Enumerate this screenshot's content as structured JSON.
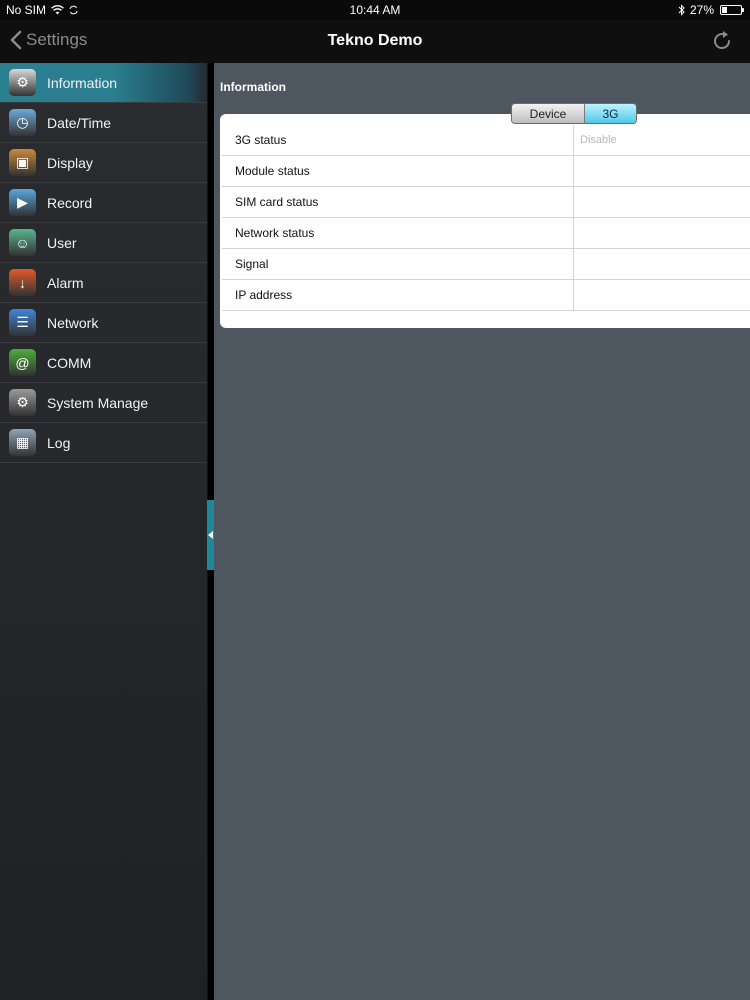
{
  "status_bar": {
    "carrier": "No SIM",
    "time": "10:44 AM",
    "battery": "27%",
    "battery_level": 0.27,
    "icons": [
      "wifi-icon",
      "sync-icon",
      "bluetooth-icon",
      "battery-icon"
    ]
  },
  "nav": {
    "back_label": "Settings",
    "title": "Tekno Demo",
    "refresh_icon": "refresh-icon"
  },
  "sidebar": {
    "items": [
      {
        "label": "Information",
        "icon": "gear-icon",
        "active": true,
        "color": "#d8d8d8"
      },
      {
        "label": "Date/Time",
        "icon": "clock-icon",
        "active": false,
        "color": "#6fa8dc"
      },
      {
        "label": "Display",
        "icon": "monitor-icon",
        "active": false,
        "color": "#c98a3a"
      },
      {
        "label": "Record",
        "icon": "record-icon",
        "active": false,
        "color": "#5aa7e0"
      },
      {
        "label": "User",
        "icon": "user-icon",
        "active": false,
        "color": "#59b58d"
      },
      {
        "label": "Alarm",
        "icon": "alarm-icon",
        "active": false,
        "color": "#e05a2a"
      },
      {
        "label": "Network",
        "icon": "network-icon",
        "active": false,
        "color": "#3f86d8"
      },
      {
        "label": "COMM",
        "icon": "at-icon",
        "active": false,
        "color": "#4caf3a"
      },
      {
        "label": "System Manage",
        "icon": "gears-icon",
        "active": false,
        "color": "#9a9a9a"
      },
      {
        "label": "Log",
        "icon": "calendar-icon",
        "active": false,
        "color": "#8fa3b5"
      }
    ]
  },
  "main": {
    "section_title": "Information",
    "segments": [
      {
        "label": "Device",
        "selected": false
      },
      {
        "label": "3G",
        "selected": true
      }
    ],
    "rows": [
      {
        "label": "3G status",
        "value": "Disable"
      },
      {
        "label": "Module status",
        "value": ""
      },
      {
        "label": "SIM card status",
        "value": ""
      },
      {
        "label": "Network status",
        "value": ""
      },
      {
        "label": "Signal",
        "value": ""
      },
      {
        "label": "IP address",
        "value": ""
      }
    ]
  }
}
